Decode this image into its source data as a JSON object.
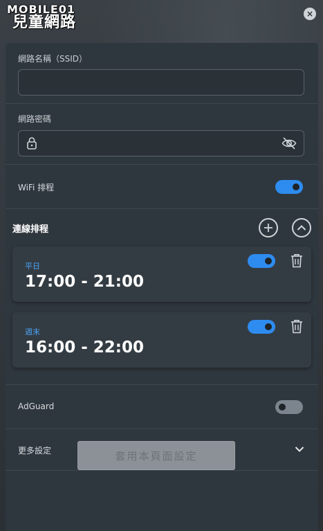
{
  "watermark": "MOBILE01",
  "header": {
    "title": "兒童網路",
    "close_icon": "×"
  },
  "ssid": {
    "label": "網路名稱（SSID）",
    "value": "",
    "placeholder": ""
  },
  "password": {
    "label": "網路密碼",
    "value": "",
    "placeholder": ""
  },
  "wifi_schedule": {
    "label": "WiFi 排程",
    "enabled": true
  },
  "connection_schedule": {
    "title": "連線排程",
    "items": [
      {
        "day": "平日",
        "time": "17:00 - 21:00",
        "enabled": true
      },
      {
        "day": "週末",
        "time": "16:00 - 22:00",
        "enabled": true
      }
    ]
  },
  "adguard": {
    "label": "AdGuard",
    "enabled": false
  },
  "more_settings": {
    "label": "更多設定"
  },
  "apply_button": {
    "label": "套用本頁面設定",
    "enabled": false
  },
  "colors": {
    "accent": "#2e8cf0",
    "panel": "#2f373e",
    "day_label": "#4aa3f5"
  }
}
